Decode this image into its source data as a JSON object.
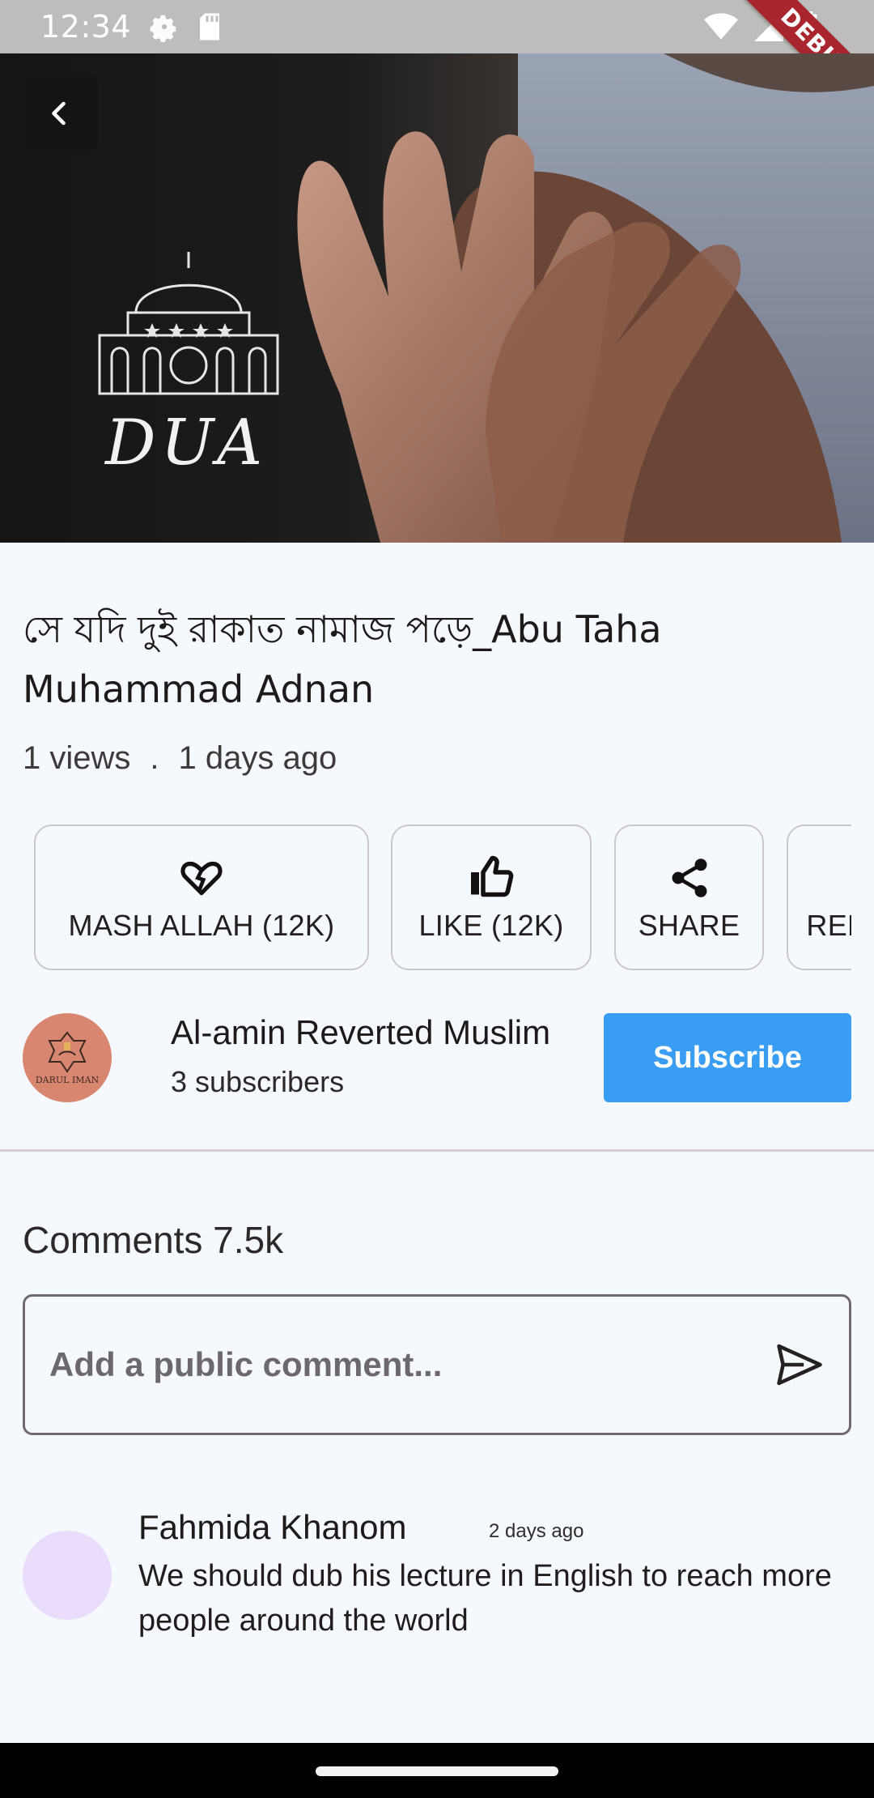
{
  "status_bar": {
    "time": "12:34",
    "debug_badge": "DEBUG"
  },
  "hero": {
    "overlay_text": "DUA",
    "back_icon": "chevron-left-icon"
  },
  "video": {
    "title": "সে যদি দুই রাকাত নামাজ পড়ে_Abu Taha Muhammad Adnan",
    "views": "1 views",
    "separator": ".",
    "age": "1 days ago"
  },
  "actions": [
    {
      "label": "MASH ALLAH (12K)",
      "icon": "broken-heart-icon"
    },
    {
      "label": "LIKE (12K)",
      "icon": "thumbs-up-icon"
    },
    {
      "label": "SHARE",
      "icon": "share-icon"
    },
    {
      "label": "REPORT",
      "icon": "flag-icon"
    }
  ],
  "channel": {
    "name": "Al-amin Reverted Muslim",
    "subscribers": "3 subscribers",
    "avatar_text": "DARUL IMAN",
    "subscribe_label": "Subscribe"
  },
  "comments": {
    "title": "Comments 7.5k",
    "input_placeholder": "Add a public comment...",
    "items": [
      {
        "author": "Fahmida Khanom",
        "time": "2 days ago",
        "text": "We should dub his lecture in English to reach more people around the world"
      }
    ]
  },
  "colors": {
    "accent": "#3a9df4",
    "background": "#f5f8fc",
    "debug_ribbon": "#a9262f",
    "channel_avatar": "#d88670",
    "comment_avatar": "#e9ddfb"
  }
}
